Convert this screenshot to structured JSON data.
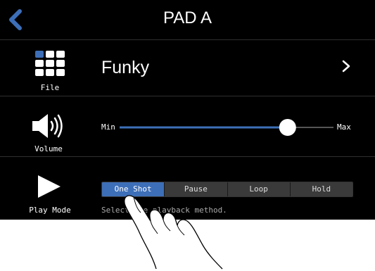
{
  "header": {
    "title": "PAD A"
  },
  "file_row": {
    "label": "File",
    "value": "Funky"
  },
  "volume_row": {
    "label": "Volume",
    "min_label": "Min",
    "max_label": "Max",
    "level": 0.81
  },
  "play_mode_row": {
    "label": "Play Mode",
    "options": [
      "One Shot",
      "Pause",
      "Loop",
      "Hold"
    ],
    "selected": "One Shot",
    "hint": "Select the playback method."
  },
  "colors": {
    "accent": "#3d6fb8",
    "background": "#000000",
    "text": "#ffffff"
  },
  "icons": [
    "back-icon",
    "file-grid-icon",
    "chevron-right-icon",
    "speaker-icon",
    "play-icon",
    "hand-pointer"
  ]
}
